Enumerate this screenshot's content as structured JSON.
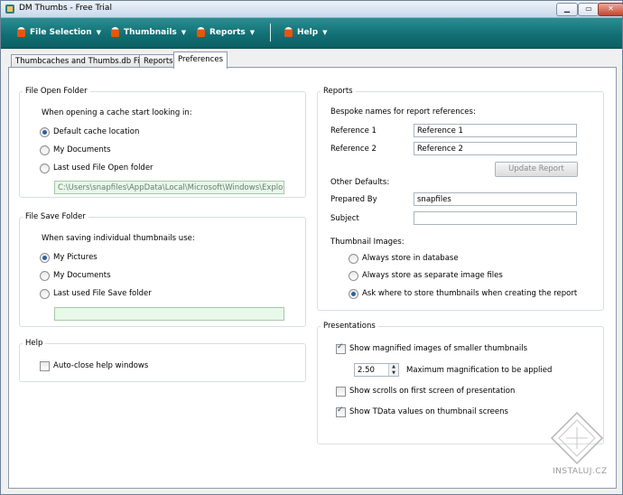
{
  "window": {
    "title": "DM Thumbs - Free Trial"
  },
  "menu": [
    "File Selection",
    "Thumbnails",
    "Reports",
    "Help"
  ],
  "tabs": [
    "Thumbcaches and Thumbs.db Files",
    "Reports",
    "Preferences"
  ],
  "file_open": {
    "legend": "File Open Folder",
    "prompt": "When opening a cache start looking in:",
    "options": [
      "Default cache location",
      "My Documents",
      "Last used File Open folder"
    ],
    "selected": 0,
    "path": "C:\\Users\\snapfiles\\AppData\\Local\\Microsoft\\Windows\\Explorer"
  },
  "file_save": {
    "legend": "File Save Folder",
    "prompt": "When saving individual thumbnails use:",
    "options": [
      "My Pictures",
      "My Documents",
      "Last used File Save folder"
    ],
    "selected": 0,
    "path": ""
  },
  "help": {
    "legend": "Help",
    "autoclose_label": "Auto-close help windows",
    "autoclose": false
  },
  "reports": {
    "legend": "Reports",
    "bespoke_label": "Bespoke names for report references:",
    "ref1_label": "Reference 1",
    "ref1_value": "Reference 1",
    "ref2_label": "Reference 2",
    "ref2_value": "Reference 2",
    "update_button": "Update Report",
    "other_defaults": "Other Defaults:",
    "prepared_by_label": "Prepared By",
    "prepared_by_value": "snapfiles",
    "subject_label": "Subject",
    "subject_value": "",
    "thumb_images_label": "Thumbnail Images:",
    "thumb_options": [
      "Always store in database",
      "Always store as separate image files",
      "Ask where to store thumbnails when creating the report"
    ],
    "thumb_selected": 2
  },
  "presentations": {
    "legend": "Presentations",
    "show_magnified": "Show magnified images of smaller thumbnails",
    "show_magnified_checked": true,
    "magnification_value": "2.50",
    "magnification_label": "Maximum magnification to be applied",
    "show_scrolls": "Show scrolls on first screen of presentation",
    "show_scrolls_checked": false,
    "show_tdata": "Show TData values on thumbnail screens",
    "show_tdata_checked": true
  },
  "watermark": "INSTALUJ.CZ"
}
